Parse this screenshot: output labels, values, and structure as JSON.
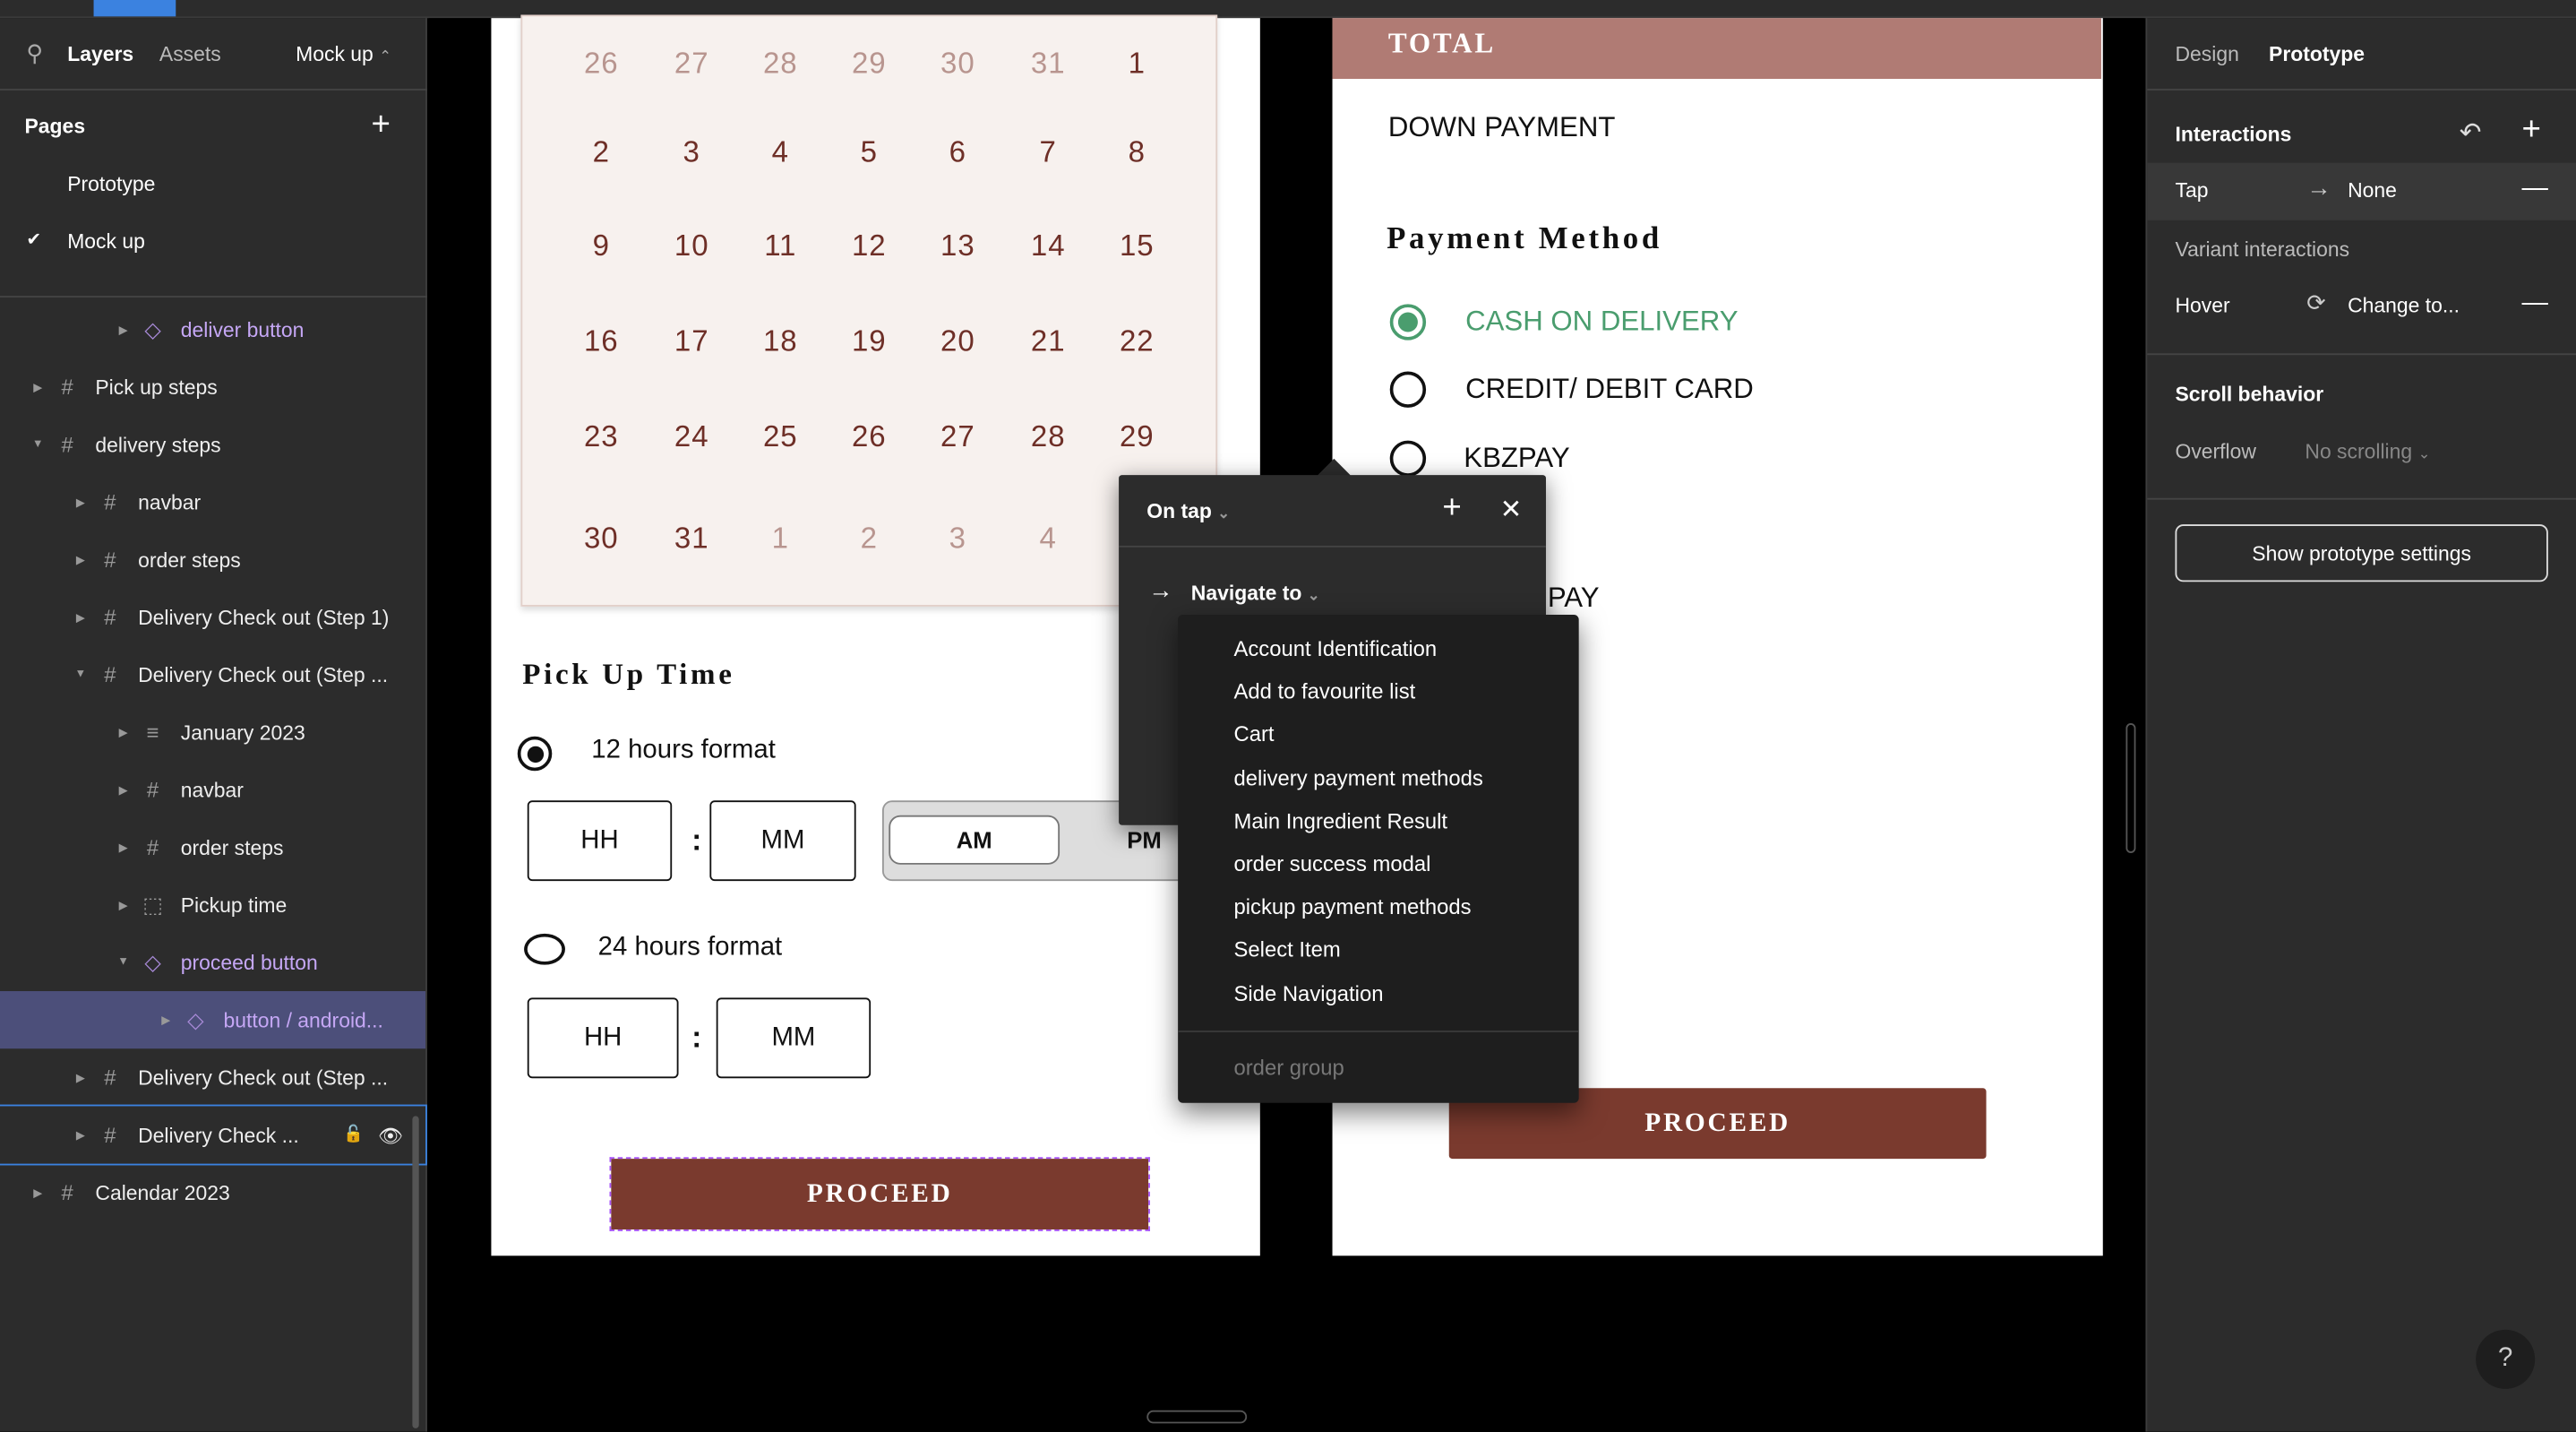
{
  "left_panel": {
    "tabs": [
      "Layers",
      "Assets"
    ],
    "page_selector": "Mock up",
    "pages_label": "Pages",
    "pages": [
      {
        "label": "Prototype",
        "current": false
      },
      {
        "label": "Mock up",
        "current": true
      }
    ],
    "layers": [
      {
        "label": "deliver button",
        "indent": 3,
        "icon": "component-icon",
        "expanded": false,
        "purple": true
      },
      {
        "label": "Pick up steps",
        "indent": 1,
        "icon": "frame-icon",
        "expanded": false
      },
      {
        "label": "delivery steps",
        "indent": 1,
        "icon": "frame-icon",
        "expanded": true
      },
      {
        "label": "navbar",
        "indent": 2,
        "icon": "frame-icon",
        "expanded": false
      },
      {
        "label": "order steps",
        "indent": 2,
        "icon": "frame-icon",
        "expanded": false
      },
      {
        "label": "Delivery Check out (Step 1)",
        "indent": 2,
        "icon": "frame-icon",
        "expanded": false
      },
      {
        "label": "Delivery Check out (Step ...",
        "indent": 2,
        "icon": "frame-icon",
        "expanded": true
      },
      {
        "label": "January 2023",
        "indent": 3,
        "icon": "auto-layout-icon",
        "expanded": false
      },
      {
        "label": "navbar",
        "indent": 3,
        "icon": "frame-icon",
        "expanded": false
      },
      {
        "label": "order steps",
        "indent": 3,
        "icon": "frame-icon",
        "expanded": false
      },
      {
        "label": "Pickup time",
        "indent": 3,
        "icon": "group-icon",
        "expanded": false
      },
      {
        "label": "proceed button",
        "indent": 3,
        "icon": "component-icon",
        "expanded": true,
        "purple": true
      },
      {
        "label": "button / android...",
        "indent": 4,
        "icon": "instance-icon",
        "expanded": false,
        "purple": true,
        "selected": true
      },
      {
        "label": "Delivery Check out (Step ...",
        "indent": 2,
        "icon": "frame-icon",
        "expanded": false
      },
      {
        "label": "Delivery Check ...",
        "indent": 2,
        "icon": "frame-icon",
        "expanded": false,
        "hovered": true
      },
      {
        "label": "Calendar 2023",
        "indent": 1,
        "icon": "frame-icon",
        "expanded": false
      }
    ]
  },
  "canvas": {
    "calendar": {
      "rows": [
        [
          {
            "d": "26",
            "dim": true
          },
          {
            "d": "27",
            "dim": true
          },
          {
            "d": "28",
            "dim": true
          },
          {
            "d": "29",
            "dim": true
          },
          {
            "d": "30",
            "dim": true
          },
          {
            "d": "31",
            "dim": true
          },
          {
            "d": "1"
          }
        ],
        [
          {
            "d": "2"
          },
          {
            "d": "3"
          },
          {
            "d": "4"
          },
          {
            "d": "5"
          },
          {
            "d": "6"
          },
          {
            "d": "7"
          },
          {
            "d": "8"
          }
        ],
        [
          {
            "d": "9"
          },
          {
            "d": "10"
          },
          {
            "d": "11"
          },
          {
            "d": "12"
          },
          {
            "d": "13"
          },
          {
            "d": "14"
          },
          {
            "d": "15"
          }
        ],
        [
          {
            "d": "16"
          },
          {
            "d": "17"
          },
          {
            "d": "18"
          },
          {
            "d": "19"
          },
          {
            "d": "20"
          },
          {
            "d": "21"
          },
          {
            "d": "22"
          }
        ],
        [
          {
            "d": "23"
          },
          {
            "d": "24"
          },
          {
            "d": "25"
          },
          {
            "d": "26"
          },
          {
            "d": "27"
          },
          {
            "d": "28"
          },
          {
            "d": "29"
          }
        ],
        [
          {
            "d": "30"
          },
          {
            "d": "31"
          },
          {
            "d": "1",
            "dim": true
          },
          {
            "d": "2",
            "dim": true
          },
          {
            "d": "3",
            "dim": true
          },
          {
            "d": "4",
            "dim": true
          }
        ]
      ]
    },
    "pickup": {
      "title": "Pick Up Time",
      "format12": "12 hours format",
      "format24": "24 hours format",
      "hh": "HH",
      "mm": "MM",
      "colon": ":",
      "am": "AM",
      "pm": "PM",
      "proceed": "PROCEED"
    },
    "payment": {
      "total": "TOTAL",
      "down_payment": "DOWN PAYMENT",
      "method_title": "Payment Method",
      "options": [
        "CASH ON DELIVERY",
        "CREDIT/ DEBIT CARD",
        "KBZPAY"
      ],
      "partial_option": "PAY",
      "proceed": "PROCEED"
    }
  },
  "popover": {
    "trigger": "On tap",
    "action": "Navigate to",
    "destinations": [
      "Account Identification",
      "Add to favourite list",
      "Cart",
      "delivery payment methods",
      "Main Ingredient Result",
      "order success modal",
      "pickup payment methods",
      "Select Item",
      "Side Navigation"
    ],
    "group_label": "order group"
  },
  "right_panel": {
    "tabs": [
      "Design",
      "Prototype"
    ],
    "interactions_label": "Interactions",
    "tap": {
      "trigger": "Tap",
      "action": "None"
    },
    "variant_label": "Variant interactions",
    "hover": {
      "trigger": "Hover",
      "action": "Change to..."
    },
    "scroll_label": "Scroll behavior",
    "overflow_label": "Overflow",
    "overflow_value": "No scrolling",
    "settings_button": "Show prototype settings",
    "help": "?"
  },
  "colors": {
    "accent": "#3b82e0",
    "brand": "#7a3a2e",
    "total_bar": "#b07b74",
    "selected_radio": "#4a9d6e",
    "component": "#c5a7f5"
  }
}
